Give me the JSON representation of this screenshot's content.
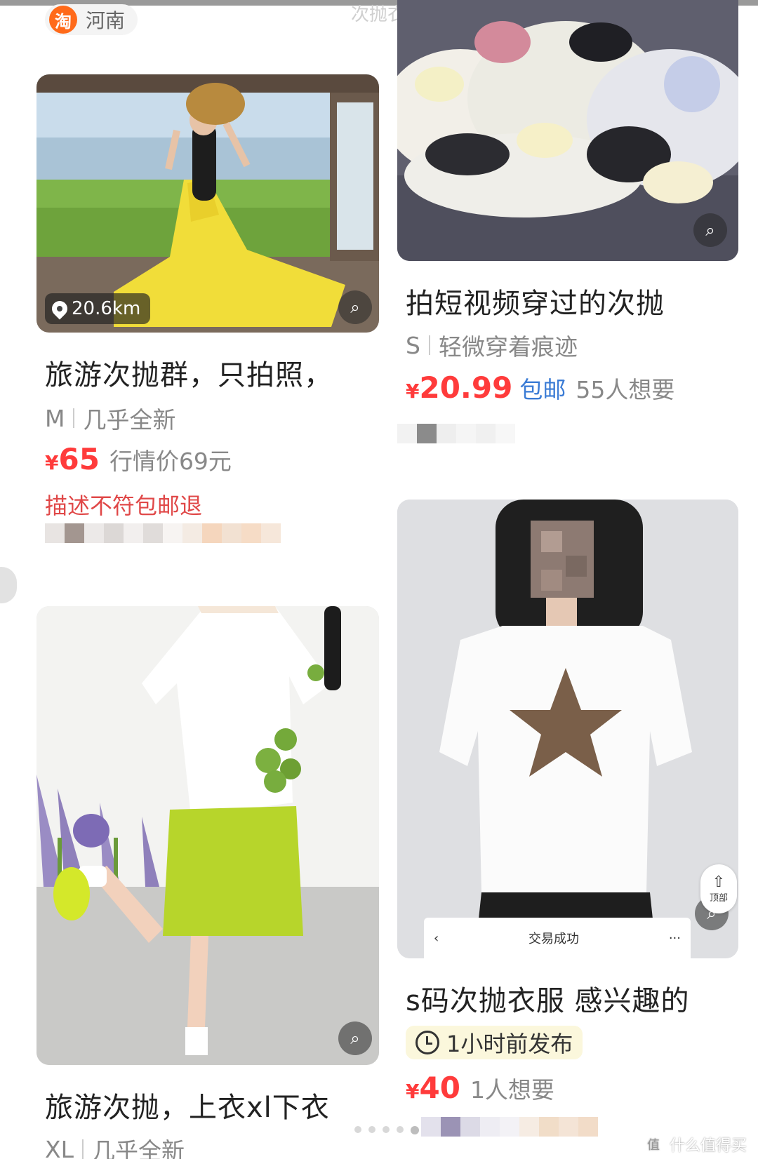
{
  "header": {
    "platform_badge": "淘",
    "location": "河南",
    "faded_text": "次抛衣服分享"
  },
  "watermark": {
    "badge": "值",
    "text": "什么值得买"
  },
  "back_to_top": {
    "arrow": "⇧",
    "label": "顶部"
  },
  "cards": [
    {
      "distance": "20.6km",
      "title": "旅游次抛群，只拍照，",
      "size": "M",
      "condition": "几乎全新",
      "currency": "¥",
      "price": "65",
      "market_price": "行情价69元",
      "promo": "描述不符包邮退"
    },
    {
      "title": "拍短视频穿过的次抛",
      "size": "S",
      "condition": "轻微穿着痕迹",
      "currency": "¥",
      "price": "20.99",
      "shipping": "包邮",
      "wants": "55人想要"
    },
    {
      "title": "旅游次抛，上衣xl下衣",
      "size": "XL",
      "condition": "几乎全新"
    },
    {
      "overlay_title": "交易成功",
      "overlay_back": "‹",
      "overlay_more": "···",
      "title": "s码次抛衣服 感兴趣的",
      "time_tag": "1小时前发布",
      "currency": "¥",
      "price": "40",
      "wants": "1人想要"
    }
  ],
  "colors": {
    "price_red": "#ff3b3b",
    "shipping_blue": "#3a7bd5",
    "promo_red": "#e04848",
    "badge_orange": "#ff6a1a"
  },
  "icons": [
    "location-pin-icon",
    "image-search-icon",
    "clock-icon",
    "taobao-badge-icon",
    "back-to-top-icon"
  ]
}
